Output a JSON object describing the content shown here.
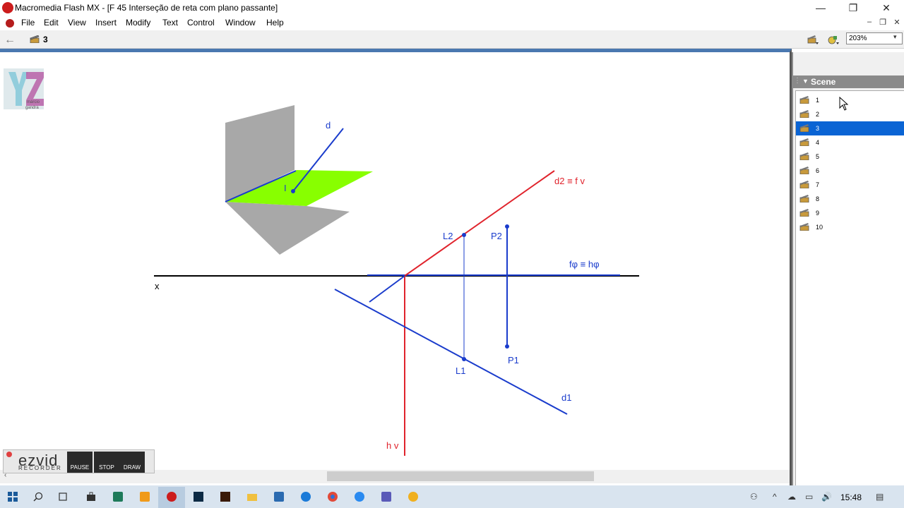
{
  "window": {
    "title": "Macromedia Flash MX - [F 45 Interseção de reta com plano passante]",
    "minimize": "—",
    "restore": "❐",
    "close": "✕"
  },
  "menu": [
    "File",
    "Edit",
    "View",
    "Insert",
    "Modify",
    "Text",
    "Control",
    "Window",
    "Help"
  ],
  "mdi": {
    "minimize": "–",
    "restore": "❐",
    "close": "✕"
  },
  "toolbar": {
    "back_icon": "←",
    "current_scene": "3",
    "zoom": "203%",
    "zoom_arrow": "▾"
  },
  "panel": {
    "title": "Scene",
    "scenes": [
      "1",
      "2",
      "3",
      "4",
      "5",
      "6",
      "7",
      "8",
      "9",
      "10"
    ],
    "selected_index": 2
  },
  "stage": {
    "logo_text1": "márcio",
    "logo_text2": "gandra",
    "labels": {
      "d": "d",
      "I": "I",
      "d2fv": "d2 ≡ f v",
      "L2": "L2",
      "P2": "P2",
      "fh": "fφ ≡ hφ",
      "x": "x",
      "L1": "L1",
      "P1": "P1",
      "d1": "d1",
      "hv": "h v"
    },
    "colors": {
      "red": "#e0232c",
      "blue": "#1a3ccc",
      "green": "#88ff00",
      "gray": "#a8a8a8"
    }
  },
  "ezvid": {
    "logo": "ezvid",
    "sub": "RECORDER",
    "buttons": [
      "PAUSE",
      "STOP",
      "DRAW"
    ]
  },
  "scrollbar": {
    "left_arrow": "‹"
  },
  "taskbar": {
    "time": "15:48",
    "tray_up": "^",
    "tray_volume": "🔊"
  }
}
